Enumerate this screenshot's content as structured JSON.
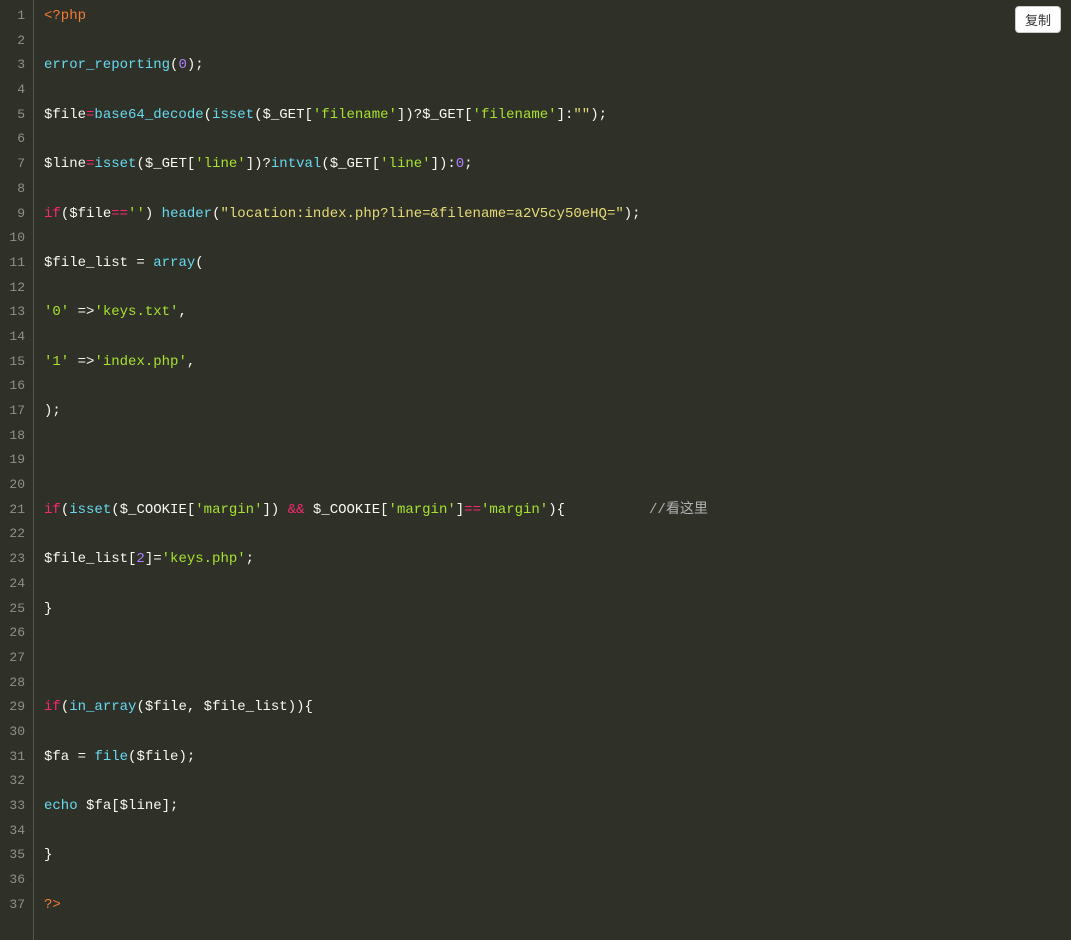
{
  "copy_button_label": "复制",
  "line_count": 37,
  "code_lines": {
    "l1": [
      {
        "t": "<?php",
        "c": "t-phptag"
      }
    ],
    "l2": [],
    "l3": [
      {
        "t": "error_reporting",
        "c": "t-fn"
      },
      {
        "t": "(",
        "c": "t-punc"
      },
      {
        "t": "0",
        "c": "t-num"
      },
      {
        "t": ");",
        "c": "t-punc"
      }
    ],
    "l4": [],
    "l5": [
      {
        "t": "$file",
        "c": "t-var"
      },
      {
        "t": "=",
        "c": "t-op"
      },
      {
        "t": "base64_decode",
        "c": "t-fn"
      },
      {
        "t": "(",
        "c": "t-punc"
      },
      {
        "t": "isset",
        "c": "t-fn"
      },
      {
        "t": "(",
        "c": "t-punc"
      },
      {
        "t": "$_GET",
        "c": "t-var"
      },
      {
        "t": "[",
        "c": "t-punc"
      },
      {
        "t": "'filename'",
        "c": "t-str"
      },
      {
        "t": "])?",
        "c": "t-punc"
      },
      {
        "t": "$_GET",
        "c": "t-var"
      },
      {
        "t": "[",
        "c": "t-punc"
      },
      {
        "t": "'filename'",
        "c": "t-str"
      },
      {
        "t": "]:",
        "c": "t-punc"
      },
      {
        "t": "\"\"",
        "c": "t-strA"
      },
      {
        "t": ");",
        "c": "t-punc"
      }
    ],
    "l6": [],
    "l7": [
      {
        "t": "$line",
        "c": "t-var"
      },
      {
        "t": "=",
        "c": "t-op"
      },
      {
        "t": "isset",
        "c": "t-fn"
      },
      {
        "t": "(",
        "c": "t-punc"
      },
      {
        "t": "$_GET",
        "c": "t-var"
      },
      {
        "t": "[",
        "c": "t-punc"
      },
      {
        "t": "'line'",
        "c": "t-str"
      },
      {
        "t": "])?",
        "c": "t-punc"
      },
      {
        "t": "intval",
        "c": "t-fn"
      },
      {
        "t": "(",
        "c": "t-punc"
      },
      {
        "t": "$_GET",
        "c": "t-var"
      },
      {
        "t": "[",
        "c": "t-punc"
      },
      {
        "t": "'line'",
        "c": "t-str"
      },
      {
        "t": "]):",
        "c": "t-punc"
      },
      {
        "t": "0",
        "c": "t-num"
      },
      {
        "t": ";",
        "c": "t-punc"
      }
    ],
    "l8": [],
    "l9": [
      {
        "t": "if",
        "c": "t-kw"
      },
      {
        "t": "(",
        "c": "t-punc"
      },
      {
        "t": "$file",
        "c": "t-var"
      },
      {
        "t": "==",
        "c": "t-op"
      },
      {
        "t": "''",
        "c": "t-str"
      },
      {
        "t": ") ",
        "c": "t-punc"
      },
      {
        "t": "header",
        "c": "t-fn"
      },
      {
        "t": "(",
        "c": "t-punc"
      },
      {
        "t": "\"location:index.php?line=&filename=a2V5cy50eHQ=\"",
        "c": "t-strA"
      },
      {
        "t": ");",
        "c": "t-punc"
      }
    ],
    "l10": [],
    "l11": [
      {
        "t": "$file_list",
        "c": "t-var"
      },
      {
        "t": " = ",
        "c": "t-punc"
      },
      {
        "t": "array",
        "c": "t-fn"
      },
      {
        "t": "(",
        "c": "t-punc"
      }
    ],
    "l12": [],
    "l13": [
      {
        "t": "'0'",
        "c": "t-str"
      },
      {
        "t": " =>",
        "c": "t-punc"
      },
      {
        "t": "'keys.txt'",
        "c": "t-str"
      },
      {
        "t": ",",
        "c": "t-punc"
      }
    ],
    "l14": [],
    "l15": [
      {
        "t": "'1'",
        "c": "t-str"
      },
      {
        "t": " =>",
        "c": "t-punc"
      },
      {
        "t": "'index.php'",
        "c": "t-str"
      },
      {
        "t": ",",
        "c": "t-punc"
      }
    ],
    "l16": [],
    "l17": [
      {
        "t": ");",
        "c": "t-punc"
      }
    ],
    "l18": [],
    "l19": [],
    "l20": [],
    "l21": [
      {
        "t": "if",
        "c": "t-kw"
      },
      {
        "t": "(",
        "c": "t-punc"
      },
      {
        "t": "isset",
        "c": "t-fn"
      },
      {
        "t": "(",
        "c": "t-punc"
      },
      {
        "t": "$_COOKIE",
        "c": "t-var"
      },
      {
        "t": "[",
        "c": "t-punc"
      },
      {
        "t": "'margin'",
        "c": "t-str"
      },
      {
        "t": "]) ",
        "c": "t-punc"
      },
      {
        "t": "&&",
        "c": "t-op"
      },
      {
        "t": " ",
        "c": "t-punc"
      },
      {
        "t": "$_COOKIE",
        "c": "t-var"
      },
      {
        "t": "[",
        "c": "t-punc"
      },
      {
        "t": "'margin'",
        "c": "t-str"
      },
      {
        "t": "]",
        "c": "t-punc"
      },
      {
        "t": "==",
        "c": "t-op"
      },
      {
        "t": "'margin'",
        "c": "t-str"
      },
      {
        "t": "){          ",
        "c": "t-punc"
      },
      {
        "t": "//看这里",
        "c": "t-cmt"
      }
    ],
    "l22": [],
    "l23": [
      {
        "t": "$file_list",
        "c": "t-var"
      },
      {
        "t": "[",
        "c": "t-punc"
      },
      {
        "t": "2",
        "c": "t-num"
      },
      {
        "t": "]=",
        "c": "t-punc"
      },
      {
        "t": "'keys.php'",
        "c": "t-str"
      },
      {
        "t": ";",
        "c": "t-punc"
      }
    ],
    "l24": [],
    "l25": [
      {
        "t": "}",
        "c": "t-punc"
      }
    ],
    "l26": [],
    "l27": [],
    "l28": [],
    "l29": [
      {
        "t": "if",
        "c": "t-kw"
      },
      {
        "t": "(",
        "c": "t-punc"
      },
      {
        "t": "in_array",
        "c": "t-fn"
      },
      {
        "t": "(",
        "c": "t-punc"
      },
      {
        "t": "$file",
        "c": "t-var"
      },
      {
        "t": ", ",
        "c": "t-punc"
      },
      {
        "t": "$file_list",
        "c": "t-var"
      },
      {
        "t": ")){",
        "c": "t-punc"
      }
    ],
    "l30": [],
    "l31": [
      {
        "t": "$fa",
        "c": "t-var"
      },
      {
        "t": " = ",
        "c": "t-punc"
      },
      {
        "t": "file",
        "c": "t-fn"
      },
      {
        "t": "(",
        "c": "t-punc"
      },
      {
        "t": "$file",
        "c": "t-var"
      },
      {
        "t": ");",
        "c": "t-punc"
      }
    ],
    "l32": [],
    "l33": [
      {
        "t": "echo",
        "c": "t-fn"
      },
      {
        "t": " ",
        "c": "t-punc"
      },
      {
        "t": "$fa",
        "c": "t-var"
      },
      {
        "t": "[",
        "c": "t-punc"
      },
      {
        "t": "$line",
        "c": "t-var"
      },
      {
        "t": "];",
        "c": "t-punc"
      }
    ],
    "l34": [],
    "l35": [
      {
        "t": "}",
        "c": "t-punc"
      }
    ],
    "l36": [],
    "l37": [
      {
        "t": "?>",
        "c": "t-phptag"
      }
    ]
  }
}
